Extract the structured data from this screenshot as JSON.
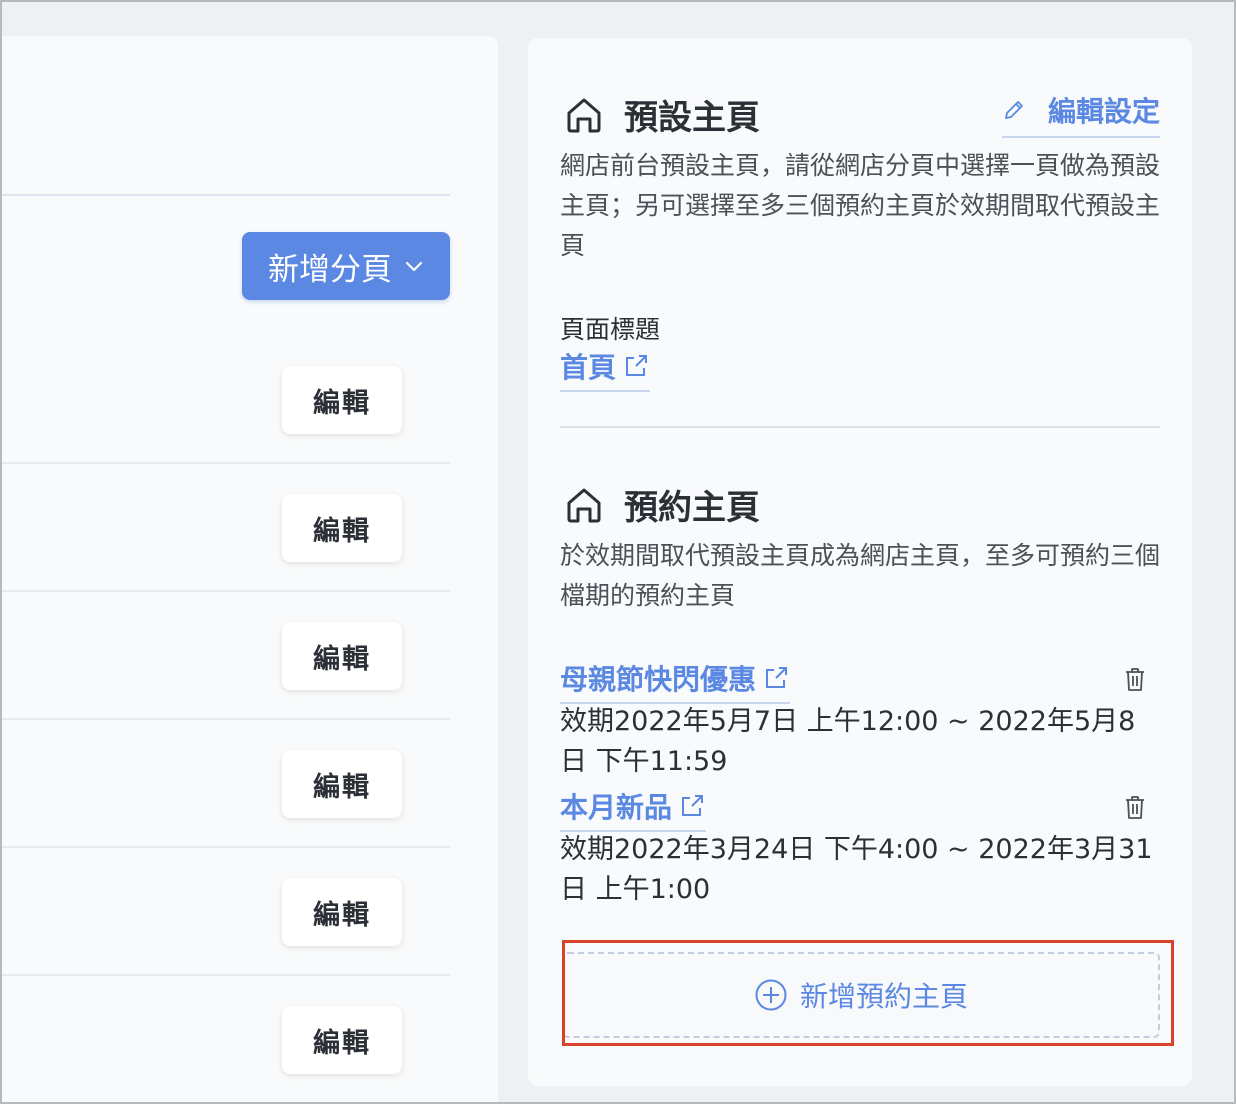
{
  "left": {
    "add_page_label": "新增分頁",
    "edit_label": "編輯",
    "rows": [
      {
        "edit": "編輯"
      },
      {
        "edit": "編輯"
      },
      {
        "edit": "編輯"
      },
      {
        "edit": "編輯"
      },
      {
        "edit": "編輯"
      },
      {
        "edit": "編輯"
      }
    ]
  },
  "default_home": {
    "title": "預設主頁",
    "edit_settings_label": "編輯設定",
    "description": "網店前台預設主頁，請從網店分頁中選擇一頁做為預設主頁；另可選擇至多三個預約主頁於效期間取代預設主頁",
    "page_title_label": "頁面標題",
    "page_title_value": "首頁"
  },
  "scheduled_home": {
    "title": "預約主頁",
    "description": "於效期間取代預設主頁成為網店主頁，至多可預約三個檔期的預約主頁",
    "items": [
      {
        "name": "母親節快閃優惠",
        "period": "效期2022年5月7日 上午12:00 ~ 2022年5月8日 下午11:59"
      },
      {
        "name": "本月新品",
        "period": "效期2022年3月24日 下午4:00 ~ 2022年3月31日 上午1:00"
      }
    ],
    "add_label": "新增預約主頁"
  },
  "colors": {
    "accent": "#5a88e2",
    "highlight": "#d9412b"
  },
  "icons": [
    "home-icon",
    "pencil-icon",
    "external-link-icon",
    "trash-icon",
    "plus-circle-icon",
    "chevron-down-icon"
  ]
}
